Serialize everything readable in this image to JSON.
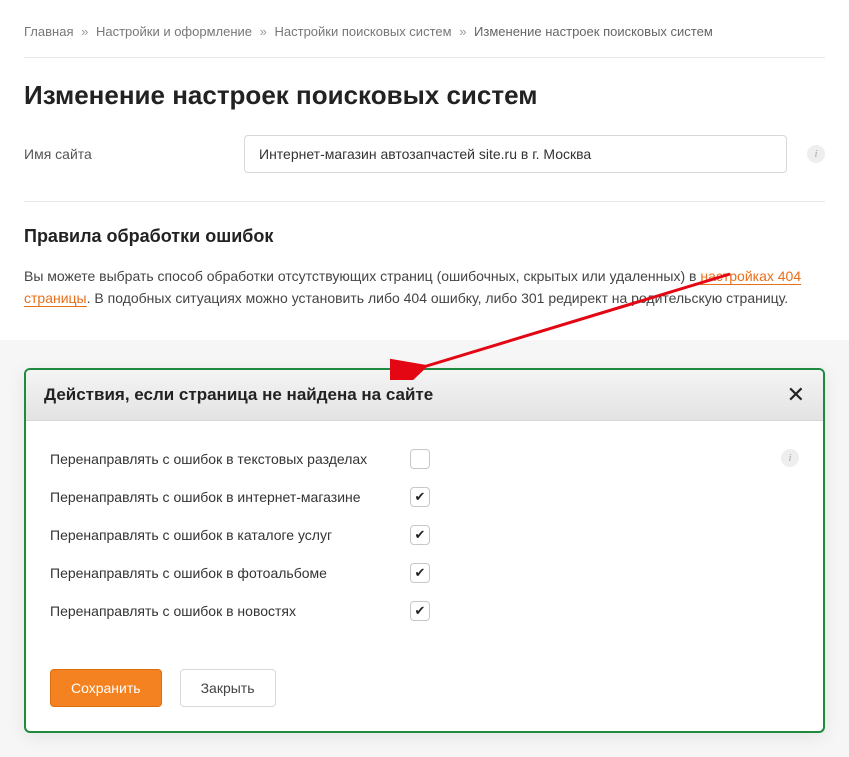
{
  "breadcrumb": {
    "items": [
      {
        "label": "Главная"
      },
      {
        "label": "Настройки и оформление"
      },
      {
        "label": "Настройки поисковых систем"
      }
    ],
    "current": "Изменение настроек поисковых систем"
  },
  "page_title": "Изменение настроек поисковых систем",
  "site_name": {
    "label": "Имя сайта",
    "value": "Интернет-магазин автозапчастей site.ru в г. Москва"
  },
  "error_rules": {
    "title": "Правила обработки ошибок",
    "text_before": "Вы можете выбрать способ обработки отсутствующих страниц (ошибочных, скрытых или удаленных) в ",
    "link_text": "настройках 404 страницы",
    "text_after": ". В подобных ситуациях можно установить либо 404 ошибку, либо 301 редирект на родительскую страницу."
  },
  "modal": {
    "title": "Действия, если страница не найдена на сайте",
    "options": [
      {
        "label": "Перенаправлять с ошибок в текстовых разделах",
        "checked": false
      },
      {
        "label": "Перенаправлять с ошибок в интернет-магазине",
        "checked": true
      },
      {
        "label": "Перенаправлять с ошибок в каталоге услуг",
        "checked": true
      },
      {
        "label": "Перенаправлять с ошибок в фотоальбоме",
        "checked": true
      },
      {
        "label": "Перенаправлять с ошибок в новостях",
        "checked": true
      }
    ],
    "save_label": "Сохранить",
    "close_label": "Закрыть"
  }
}
